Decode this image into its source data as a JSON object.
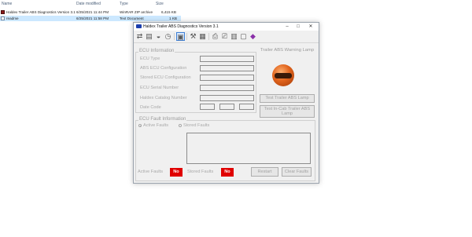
{
  "explorer": {
    "columns": {
      "name": "Name",
      "date": "Date modified",
      "type": "Type",
      "size": "Size"
    },
    "rows": [
      {
        "name": "Haldex Trailer ABS Diagnostics Version 3.1",
        "date": "6/25/2021 11:44 PM",
        "type": "WinRAR ZIP archive",
        "size": "6,415 KB",
        "icon": "rar-archive-icon"
      },
      {
        "name": "readme",
        "date": "6/25/2021 11:58 PM",
        "type": "Text Document",
        "size": "1 KB",
        "icon": "text-document-icon"
      }
    ]
  },
  "window": {
    "title": "Haldex Trailer ABS Diagnostics Version 3.1",
    "controls": {
      "minimize": "–",
      "maximize": "□",
      "close": "✕"
    }
  },
  "toolbar": {
    "icons": [
      "connect-icon",
      "database-icon",
      "disk-icon",
      "clock-icon",
      "ecu-config-icon",
      "tools-icon",
      "data-log-icon",
      "print-icon",
      "print-preview-icon",
      "report-icon",
      "document-icon",
      "help-book-icon"
    ]
  },
  "ecu_info": {
    "group_label": "ECU Information",
    "fields": [
      "ECU Type",
      "ABS ECU Configuration",
      "Stored ECU Configuration",
      "ECU Serial Number",
      "Haldex Catalog Number",
      "Date Code"
    ]
  },
  "lamp": {
    "title": "Trailer ABS Warning Lamp",
    "test_lamp_button": "Test Trailer ABS Lamp",
    "test_incab_button": "Test In-Cab Trailer ABS Lamp"
  },
  "fault_info": {
    "group_label": "ECU Fault Information",
    "active_radio": "Active Faults",
    "stored_radio": "Stored Faults",
    "active_faults_label": "Active Faults",
    "active_faults_value": "No",
    "stored_faults_label": "Stored Faults",
    "stored_faults_value": "No",
    "restart_button": "Restart",
    "clear_button": "Clear Faults"
  },
  "colors": {
    "badge_red": "#e00000",
    "selected_row": "#cce8ff",
    "lamp_orange": "#e0631c"
  }
}
